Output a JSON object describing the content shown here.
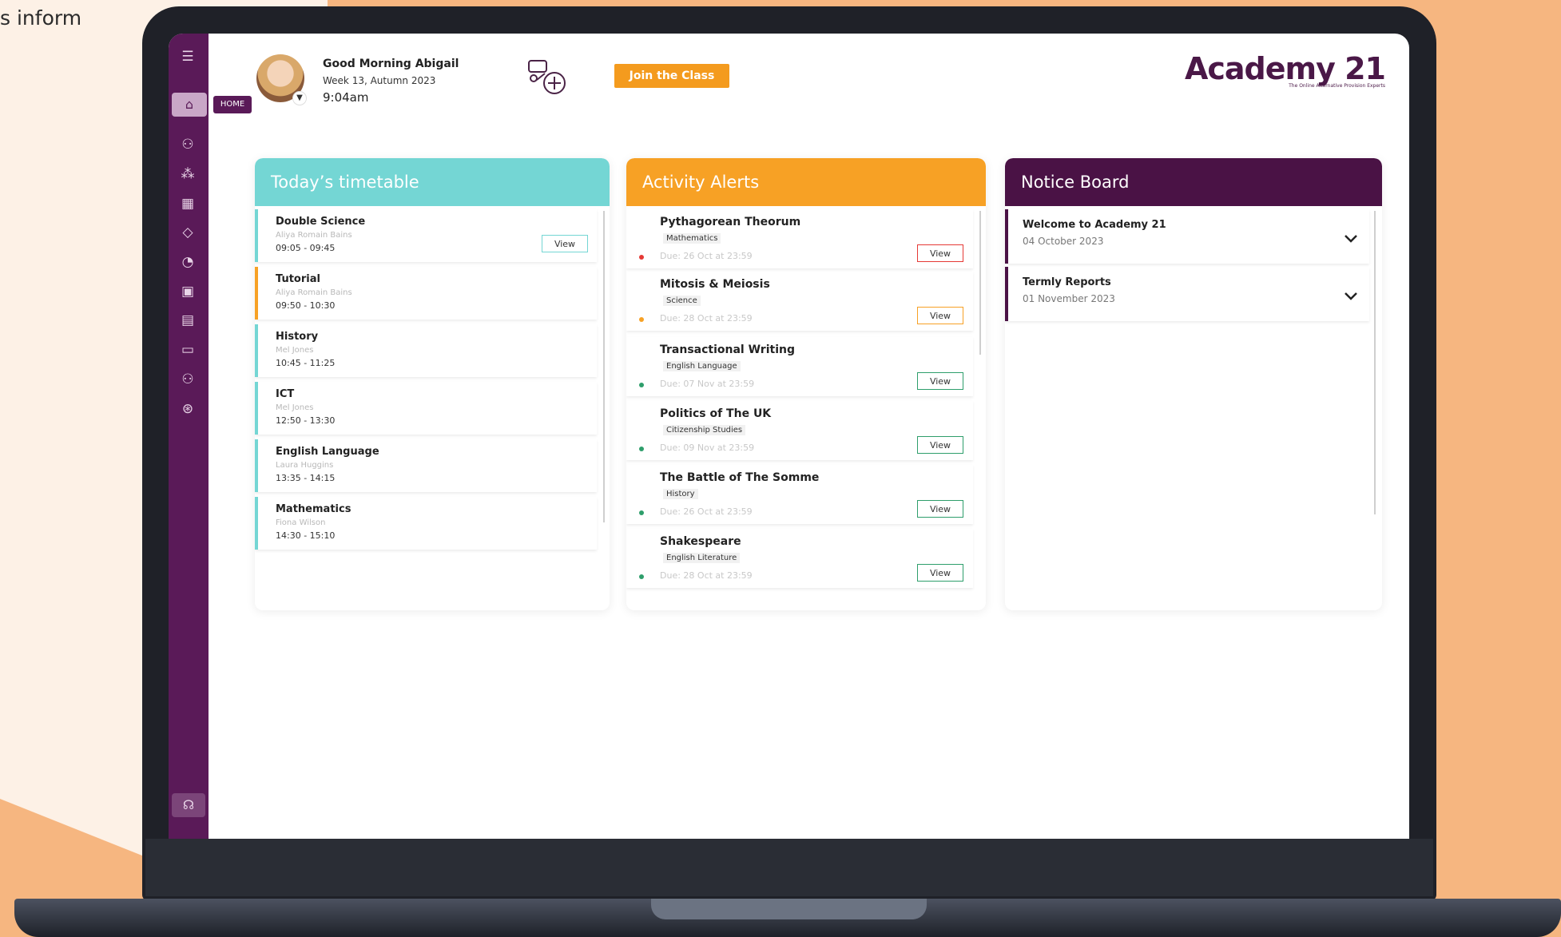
{
  "page": {
    "side_text": "s inform"
  },
  "sidebar": {
    "home_tooltip": "HOME",
    "icons": [
      "user-icon",
      "apps-icon",
      "calendar-grid-icon",
      "graduation-cap-icon",
      "chart-icon",
      "image-icon",
      "schedule-icon",
      "chat-icon",
      "people-icon",
      "settings-icon",
      "help-icon"
    ]
  },
  "header": {
    "greeting": "Good Morning Abigail",
    "week": "Week 13, Autumn 2023",
    "time": "9:04am",
    "join_label": "Join the Class",
    "logo": "Academy 21",
    "logo_tagline": "The Online Alternative Provision Experts"
  },
  "timetable": {
    "title": "Today’s timetable",
    "view_label": "View",
    "items": [
      {
        "subject": "Double Science",
        "teacher": "Aliya Romain Bains",
        "time": "09:05 - 09:45",
        "has_view": true
      },
      {
        "subject": "Tutorial",
        "teacher": "Aliya Romain Bains",
        "time": "09:50 - 10:30"
      },
      {
        "subject": "History",
        "teacher": "Mel Jones",
        "time": "10:45 - 11:25"
      },
      {
        "subject": "ICT",
        "teacher": "Mel Jones",
        "time": "12:50 - 13:30"
      },
      {
        "subject": "English Language",
        "teacher": "Laura Huggins",
        "time": "13:35 - 14:15"
      },
      {
        "subject": "Mathematics",
        "teacher": "Fiona Wilson",
        "time": "14:30 - 15:10"
      }
    ]
  },
  "activity": {
    "title": "Activity Alerts",
    "view_label": "View",
    "items": [
      {
        "title": "Pythagorean Theorum",
        "category": "Mathematics",
        "due": "Due: 26 Oct at 23:59",
        "status_color": "#e53935"
      },
      {
        "title": "Mitosis & Meiosis",
        "category": "Science",
        "due": "Due: 28 Oct at 23:59",
        "status_color": "#f7a125"
      },
      {
        "title": "Transactional Writing",
        "category": "English Language",
        "due": "Due: 07 Nov at 23:59",
        "status_color": "#2e9e6b"
      },
      {
        "title": "Politics of The UK",
        "category": "Citizenship Studies",
        "due": "Due: 09 Nov at 23:59",
        "status_color": "#2e9e6b"
      },
      {
        "title": "The Battle of The Somme",
        "category": "History",
        "due": "Due: 26 Oct at 23:59",
        "status_color": "#2e9e6b"
      },
      {
        "title": "Shakespeare",
        "category": "English Literature",
        "due": "Due: 28 Oct at 23:59",
        "status_color": "#2e9e6b"
      }
    ]
  },
  "notice": {
    "title": "Notice Board",
    "items": [
      {
        "title": "Welcome to Academy 21",
        "date": "04 October 2023"
      },
      {
        "title": "Termly Reports",
        "date": "01 November 2023"
      }
    ]
  },
  "colors": {
    "sidebar": "#5a1a58",
    "timetable_accent": "#74d6d4",
    "activity_accent": "#f7a125",
    "notice_accent": "#4a1245",
    "join_button": "#f49b1e"
  }
}
